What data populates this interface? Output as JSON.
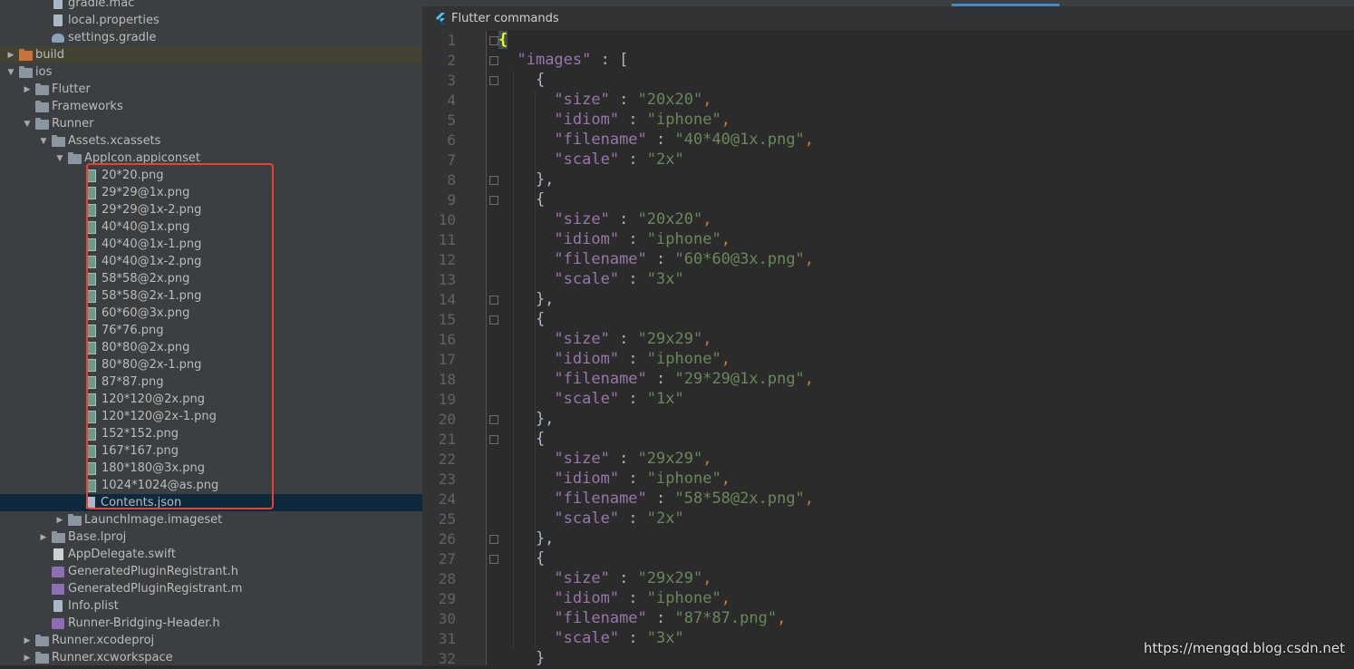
{
  "tree": {
    "rows": [
      {
        "label": "gradle.mac",
        "depth": 3,
        "icon": "file",
        "arrow": "none"
      },
      {
        "label": "local.properties",
        "depth": 3,
        "icon": "file",
        "arrow": "none"
      },
      {
        "label": "settings.gradle",
        "depth": 3,
        "icon": "gradle",
        "arrow": "none"
      },
      {
        "label": "build",
        "depth": 1,
        "icon": "folder-orange",
        "arrow": "right"
      },
      {
        "label": "ios",
        "depth": 1,
        "icon": "folder",
        "arrow": "down"
      },
      {
        "label": "Flutter",
        "depth": 2,
        "icon": "folder",
        "arrow": "right"
      },
      {
        "label": "Frameworks",
        "depth": 2,
        "icon": "folder",
        "arrow": "none"
      },
      {
        "label": "Runner",
        "depth": 2,
        "icon": "folder",
        "arrow": "down"
      },
      {
        "label": "Assets.xcassets",
        "depth": 3,
        "icon": "folder",
        "arrow": "down"
      },
      {
        "label": "AppIcon.appiconset",
        "depth": 4,
        "icon": "folder",
        "arrow": "down"
      },
      {
        "label": "20*20.png",
        "depth": 5,
        "icon": "png",
        "arrow": "none"
      },
      {
        "label": "29*29@1x.png",
        "depth": 5,
        "icon": "png",
        "arrow": "none"
      },
      {
        "label": "29*29@1x-2.png",
        "depth": 5,
        "icon": "png",
        "arrow": "none"
      },
      {
        "label": "40*40@1x.png",
        "depth": 5,
        "icon": "png",
        "arrow": "none"
      },
      {
        "label": "40*40@1x-1.png",
        "depth": 5,
        "icon": "png",
        "arrow": "none"
      },
      {
        "label": "40*40@1x-2.png",
        "depth": 5,
        "icon": "png",
        "arrow": "none"
      },
      {
        "label": "58*58@2x.png",
        "depth": 5,
        "icon": "png",
        "arrow": "none"
      },
      {
        "label": "58*58@2x-1.png",
        "depth": 5,
        "icon": "png",
        "arrow": "none"
      },
      {
        "label": "60*60@3x.png",
        "depth": 5,
        "icon": "png",
        "arrow": "none"
      },
      {
        "label": "76*76.png",
        "depth": 5,
        "icon": "png",
        "arrow": "none"
      },
      {
        "label": "80*80@2x.png",
        "depth": 5,
        "icon": "png",
        "arrow": "none"
      },
      {
        "label": "80*80@2x-1.png",
        "depth": 5,
        "icon": "png",
        "arrow": "none"
      },
      {
        "label": "87*87.png",
        "depth": 5,
        "icon": "png",
        "arrow": "none"
      },
      {
        "label": "120*120@2x.png",
        "depth": 5,
        "icon": "png",
        "arrow": "none"
      },
      {
        "label": "120*120@2x-1.png",
        "depth": 5,
        "icon": "png",
        "arrow": "none"
      },
      {
        "label": "152*152.png",
        "depth": 5,
        "icon": "png",
        "arrow": "none"
      },
      {
        "label": "167*167.png",
        "depth": 5,
        "icon": "png",
        "arrow": "none"
      },
      {
        "label": "180*180@3x.png",
        "depth": 5,
        "icon": "png",
        "arrow": "none"
      },
      {
        "label": "1024*1024@as.png",
        "depth": 5,
        "icon": "png",
        "arrow": "none"
      },
      {
        "label": "Contents.json",
        "depth": 5,
        "icon": "json",
        "arrow": "none",
        "selected": true
      },
      {
        "label": "LaunchImage.imageset",
        "depth": 4,
        "icon": "folder",
        "arrow": "right"
      },
      {
        "label": "Base.lproj",
        "depth": 3,
        "icon": "folder",
        "arrow": "right"
      },
      {
        "label": "AppDelegate.swift",
        "depth": 3,
        "icon": "swift",
        "arrow": "none"
      },
      {
        "label": "GeneratedPluginRegistrant.h",
        "depth": 3,
        "icon": "ch",
        "arrow": "none"
      },
      {
        "label": "GeneratedPluginRegistrant.m",
        "depth": 3,
        "icon": "ch",
        "arrow": "none"
      },
      {
        "label": "Info.plist",
        "depth": 3,
        "icon": "file",
        "arrow": "none"
      },
      {
        "label": "Runner-Bridging-Header.h",
        "depth": 3,
        "icon": "ch",
        "arrow": "none"
      },
      {
        "label": "Runner.xcodeproj",
        "depth": 2,
        "icon": "folder",
        "arrow": "right"
      },
      {
        "label": "Runner.xcworkspace",
        "depth": 2,
        "icon": "folder",
        "arrow": "right"
      }
    ]
  },
  "editor": {
    "banner_label": "Flutter commands",
    "line_numbers": [
      "1",
      "2",
      "3",
      "4",
      "5",
      "6",
      "7",
      "8",
      "9",
      "10",
      "11",
      "12",
      "13",
      "14",
      "15",
      "16",
      "17",
      "18",
      "19",
      "20",
      "21",
      "22",
      "23",
      "24",
      "25",
      "26",
      "27",
      "28",
      "29",
      "30",
      "31",
      "32"
    ],
    "lines": [
      [
        {
          "t": "{",
          "c": "bh"
        }
      ],
      [
        {
          "t": "  "
        },
        {
          "t": "\"images\"",
          "c": "k"
        },
        {
          "t": " : ",
          "c": "b"
        },
        {
          "t": "[",
          "c": "b"
        }
      ],
      [
        {
          "t": "    {",
          "c": "b"
        }
      ],
      [
        {
          "t": "      "
        },
        {
          "t": "\"size\"",
          "c": "k"
        },
        {
          "t": " : ",
          "c": "b"
        },
        {
          "t": "\"20x20\"",
          "c": "s"
        },
        {
          "t": ",",
          "c": "p"
        }
      ],
      [
        {
          "t": "      "
        },
        {
          "t": "\"idiom\"",
          "c": "k"
        },
        {
          "t": " : ",
          "c": "b"
        },
        {
          "t": "\"iphone\"",
          "c": "s"
        },
        {
          "t": ",",
          "c": "p"
        }
      ],
      [
        {
          "t": "      "
        },
        {
          "t": "\"filename\"",
          "c": "k"
        },
        {
          "t": " : ",
          "c": "b"
        },
        {
          "t": "\"40*40@1x.png\"",
          "c": "s"
        },
        {
          "t": ",",
          "c": "p"
        }
      ],
      [
        {
          "t": "      "
        },
        {
          "t": "\"scale\"",
          "c": "k"
        },
        {
          "t": " : ",
          "c": "b"
        },
        {
          "t": "\"2x\"",
          "c": "s"
        }
      ],
      [
        {
          "t": "    },",
          "c": "b"
        }
      ],
      [
        {
          "t": "    {",
          "c": "b"
        }
      ],
      [
        {
          "t": "      "
        },
        {
          "t": "\"size\"",
          "c": "k"
        },
        {
          "t": " : ",
          "c": "b"
        },
        {
          "t": "\"20x20\"",
          "c": "s"
        },
        {
          "t": ",",
          "c": "p"
        }
      ],
      [
        {
          "t": "      "
        },
        {
          "t": "\"idiom\"",
          "c": "k"
        },
        {
          "t": " : ",
          "c": "b"
        },
        {
          "t": "\"iphone\"",
          "c": "s"
        },
        {
          "t": ",",
          "c": "p"
        }
      ],
      [
        {
          "t": "      "
        },
        {
          "t": "\"filename\"",
          "c": "k"
        },
        {
          "t": " : ",
          "c": "b"
        },
        {
          "t": "\"60*60@3x.png\"",
          "c": "s"
        },
        {
          "t": ",",
          "c": "p"
        }
      ],
      [
        {
          "t": "      "
        },
        {
          "t": "\"scale\"",
          "c": "k"
        },
        {
          "t": " : ",
          "c": "b"
        },
        {
          "t": "\"3x\"",
          "c": "s"
        }
      ],
      [
        {
          "t": "    },",
          "c": "b"
        }
      ],
      [
        {
          "t": "    {",
          "c": "b"
        }
      ],
      [
        {
          "t": "      "
        },
        {
          "t": "\"size\"",
          "c": "k"
        },
        {
          "t": " : ",
          "c": "b"
        },
        {
          "t": "\"29x29\"",
          "c": "s"
        },
        {
          "t": ",",
          "c": "p"
        }
      ],
      [
        {
          "t": "      "
        },
        {
          "t": "\"idiom\"",
          "c": "k"
        },
        {
          "t": " : ",
          "c": "b"
        },
        {
          "t": "\"iphone\"",
          "c": "s"
        },
        {
          "t": ",",
          "c": "p"
        }
      ],
      [
        {
          "t": "      "
        },
        {
          "t": "\"filename\"",
          "c": "k"
        },
        {
          "t": " : ",
          "c": "b"
        },
        {
          "t": "\"29*29@1x.png\"",
          "c": "s"
        },
        {
          "t": ",",
          "c": "p"
        }
      ],
      [
        {
          "t": "      "
        },
        {
          "t": "\"scale\"",
          "c": "k"
        },
        {
          "t": " : ",
          "c": "b"
        },
        {
          "t": "\"1x\"",
          "c": "s"
        }
      ],
      [
        {
          "t": "    },",
          "c": "b"
        }
      ],
      [
        {
          "t": "    {",
          "c": "b"
        }
      ],
      [
        {
          "t": "      "
        },
        {
          "t": "\"size\"",
          "c": "k"
        },
        {
          "t": " : ",
          "c": "b"
        },
        {
          "t": "\"29x29\"",
          "c": "s"
        },
        {
          "t": ",",
          "c": "p"
        }
      ],
      [
        {
          "t": "      "
        },
        {
          "t": "\"idiom\"",
          "c": "k"
        },
        {
          "t": " : ",
          "c": "b"
        },
        {
          "t": "\"iphone\"",
          "c": "s"
        },
        {
          "t": ",",
          "c": "p"
        }
      ],
      [
        {
          "t": "      "
        },
        {
          "t": "\"filename\"",
          "c": "k"
        },
        {
          "t": " : ",
          "c": "b"
        },
        {
          "t": "\"58*58@2x.png\"",
          "c": "s"
        },
        {
          "t": ",",
          "c": "p"
        }
      ],
      [
        {
          "t": "      "
        },
        {
          "t": "\"scale\"",
          "c": "k"
        },
        {
          "t": " : ",
          "c": "b"
        },
        {
          "t": "\"2x\"",
          "c": "s"
        }
      ],
      [
        {
          "t": "    },",
          "c": "b"
        }
      ],
      [
        {
          "t": "    {",
          "c": "b"
        }
      ],
      [
        {
          "t": "      "
        },
        {
          "t": "\"size\"",
          "c": "k"
        },
        {
          "t": " : ",
          "c": "b"
        },
        {
          "t": "\"29x29\"",
          "c": "s"
        },
        {
          "t": ",",
          "c": "p"
        }
      ],
      [
        {
          "t": "      "
        },
        {
          "t": "\"idiom\"",
          "c": "k"
        },
        {
          "t": " : ",
          "c": "b"
        },
        {
          "t": "\"iphone\"",
          "c": "s"
        },
        {
          "t": ",",
          "c": "p"
        }
      ],
      [
        {
          "t": "      "
        },
        {
          "t": "\"filename\"",
          "c": "k"
        },
        {
          "t": " : ",
          "c": "b"
        },
        {
          "t": "\"87*87.png\"",
          "c": "s"
        },
        {
          "t": ",",
          "c": "p"
        }
      ],
      [
        {
          "t": "      "
        },
        {
          "t": "\"scale\"",
          "c": "k"
        },
        {
          "t": " : ",
          "c": "b"
        },
        {
          "t": "\"3x\"",
          "c": "s"
        }
      ],
      [
        {
          "t": "    }",
          "c": "b"
        }
      ]
    ]
  },
  "watermark": "https://mengqd.blog.csdn.net",
  "colors": {
    "accent": "#4a88c7",
    "highlight_box": "#e8432e",
    "json_key": "#9876aa",
    "json_string": "#6a8759",
    "punctuation": "#cc7832"
  }
}
